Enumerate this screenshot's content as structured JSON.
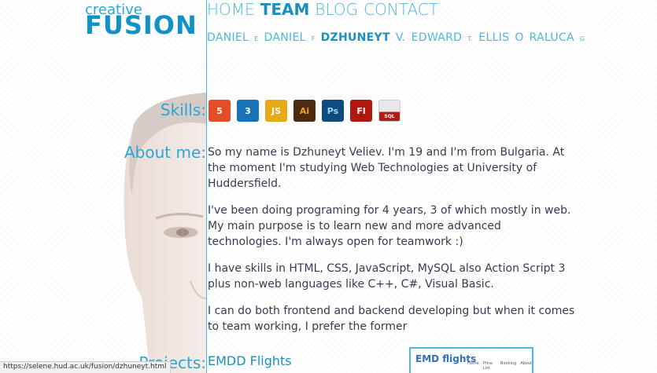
{
  "logo": {
    "top": "creative",
    "main": "FUSION"
  },
  "nav": [
    {
      "label": "HOME",
      "active": false
    },
    {
      "label": "TEAM",
      "active": true
    },
    {
      "label": "BLOG",
      "active": false
    },
    {
      "label": "CONTACT",
      "active": false
    }
  ],
  "team": [
    {
      "first": "DANIEL",
      "initial": "E"
    },
    {
      "first": "DANIEL",
      "initial": "F"
    },
    {
      "first": "DZHUNEYT",
      "initial": "V."
    },
    {
      "first": "EDWARD",
      "initial": "T."
    },
    {
      "first": "ELLIS",
      "initial": "O"
    },
    {
      "first": "RALUCA",
      "initial": "G"
    }
  ],
  "sections": {
    "skills": "Skills:",
    "about": "About me:",
    "projects": "Projects:"
  },
  "skills": [
    {
      "icon": "html5-icon",
      "text": "5",
      "color": "#e44d26"
    },
    {
      "icon": "css3-icon",
      "text": "3",
      "color": "#1572b6"
    },
    {
      "icon": "js-icon",
      "text": "JS",
      "color": "#e8a917"
    },
    {
      "icon": "illustrator-icon",
      "text": "Ai",
      "color": "#4b2a12"
    },
    {
      "icon": "photoshop-icon",
      "text": "Ps",
      "color": "#0c4c80"
    },
    {
      "icon": "flash-icon",
      "text": "Fl",
      "color": "#b0180f"
    },
    {
      "icon": "sql-icon",
      "text": "SQL",
      "color": "#ffffff"
    }
  ],
  "about": [
    "So my name is Dzhuneyt Veliev. I'm 19 and I'm from Bulgaria. At the moment I'm studying Web Technologies at University of Huddersfield.",
    "I've been doing programing for 4 years, 3 of which mostly in web. My main purpose is to learn new and more advanced technologies. I'm always open for teamwork :)",
    "I have skills in HTML, CSS, JavaScript, MySQL also Action Script 3 plus non-web languages like C++, C#, Visual Basic.",
    "I can do both frontend and backend developing but when it comes to team working, I prefer the former"
  ],
  "project": {
    "title": "EMDD Flights",
    "thumb_logo": "EMD flights",
    "thumb_menu": [
      "Home",
      "Price List",
      "Booking",
      "About"
    ]
  },
  "status_url": "https://selene.hud.ac.uk/fusion/dzhuneyt.html"
}
